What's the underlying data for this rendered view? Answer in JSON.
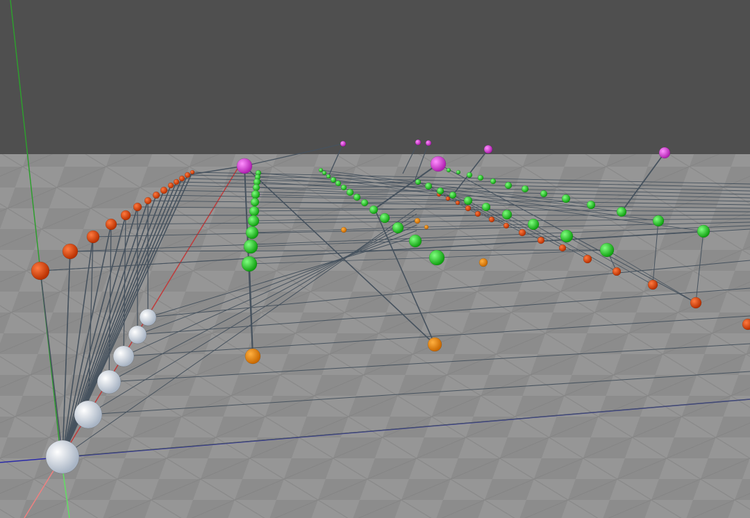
{
  "scene": {
    "background_color": "#4f4f4f",
    "floor_color": "#8a8a8a",
    "axis_colors": {
      "x": "#c03a3a",
      "y": "#2e9e2e",
      "z": "#2a2aa8"
    },
    "node_colors": {
      "white": "#e8eef4",
      "orange_red": "#e04a10",
      "orange": "#f08a10",
      "green": "#22dd22",
      "magenta": "#e040e0"
    },
    "edge_color": "#4a5560"
  }
}
